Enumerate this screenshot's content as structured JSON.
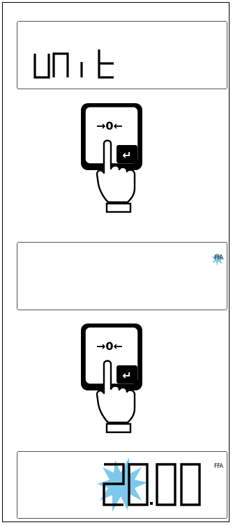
{
  "steps": [
    {
      "display": {
        "text": "unit",
        "indicator": ""
      }
    },
    {
      "key": {
        "symbol": "→0←",
        "enter_glyph": "↵",
        "icon": "zero-tare-enter-key-icon"
      }
    },
    {
      "display": {
        "text": "",
        "indicator": "FFA",
        "indicator_state": "blinking"
      }
    },
    {
      "key": {
        "symbol": "→0←",
        "enter_glyph": "↵",
        "icon": "zero-tare-enter-key-icon"
      }
    },
    {
      "display": {
        "text": "20.00",
        "indicator": "FFA",
        "blinking_digit": "2"
      }
    }
  ],
  "colors": {
    "flash": "#7ec8ee",
    "outline": "#000000",
    "display_border": "#555555"
  }
}
